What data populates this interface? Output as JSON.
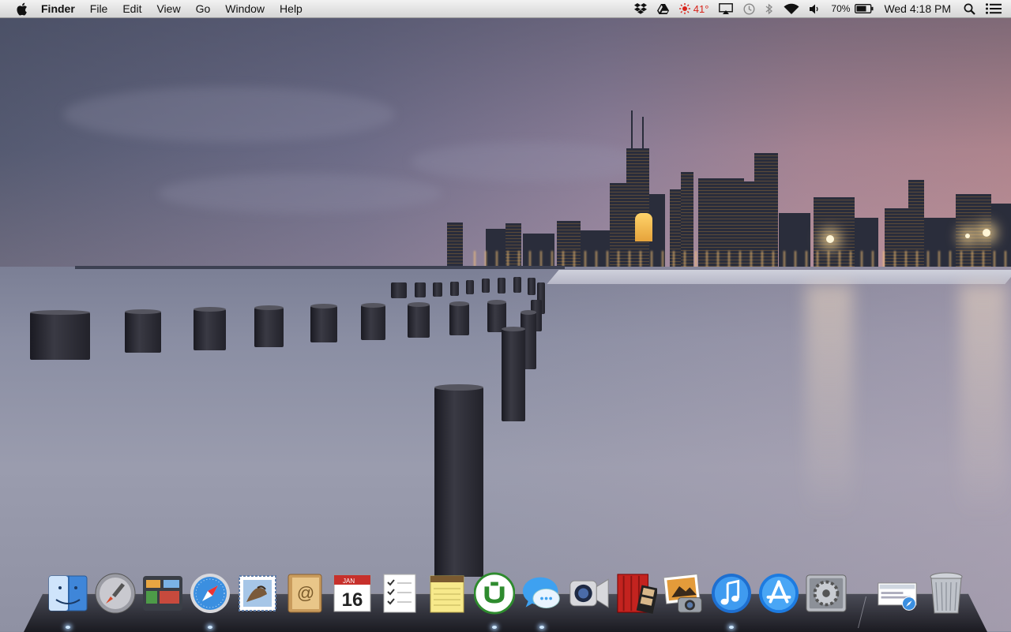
{
  "menubar": {
    "app_name": "Finder",
    "menus": [
      "File",
      "Edit",
      "View",
      "Go",
      "Window",
      "Help"
    ],
    "status": {
      "temperature": "41°",
      "battery_percent": "70%",
      "datetime": "Wed 4:18 PM"
    }
  },
  "dock": {
    "apps": [
      {
        "name": "Finder",
        "icon": "finder-icon"
      },
      {
        "name": "Launchpad",
        "icon": "launchpad-icon"
      },
      {
        "name": "Mission Control",
        "icon": "mission-control-icon"
      },
      {
        "name": "Safari",
        "icon": "safari-icon"
      },
      {
        "name": "Mail",
        "icon": "mail-icon"
      },
      {
        "name": "Contacts",
        "icon": "contacts-icon"
      },
      {
        "name": "Calendar",
        "icon": "calendar-icon",
        "badge_month": "JAN",
        "badge_day": "16"
      },
      {
        "name": "Reminders",
        "icon": "reminders-icon"
      },
      {
        "name": "Notes",
        "icon": "notes-icon"
      },
      {
        "name": "uTorrent",
        "icon": "utorrent-icon"
      },
      {
        "name": "Messages",
        "icon": "messages-icon"
      },
      {
        "name": "FaceTime",
        "icon": "facetime-icon"
      },
      {
        "name": "Photo Booth",
        "icon": "photo-booth-icon"
      },
      {
        "name": "iPhoto",
        "icon": "iphoto-icon"
      },
      {
        "name": "iTunes",
        "icon": "itunes-icon"
      },
      {
        "name": "App Store",
        "icon": "app-store-icon"
      },
      {
        "name": "System Preferences",
        "icon": "system-preferences-icon"
      },
      {
        "name": "Downloads",
        "icon": "downloads-stack-icon"
      },
      {
        "name": "Trash",
        "icon": "trash-icon"
      }
    ]
  }
}
